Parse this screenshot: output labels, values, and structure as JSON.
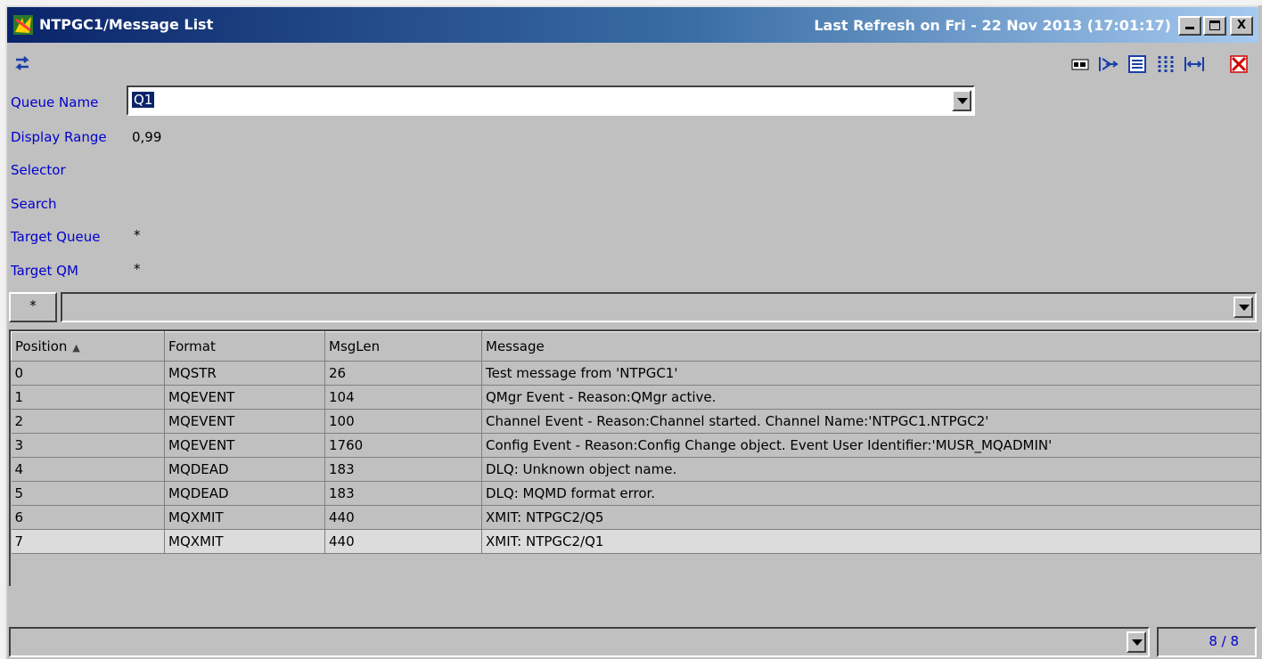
{
  "window": {
    "title": "NTPGC1/Message List",
    "last_refresh": "Last Refresh on Fri - 22 Nov 2013 (17:01:17)",
    "min_label": "_",
    "max_label": "□",
    "close_label": "X"
  },
  "toolbar": {
    "icons": [
      "refresh-icon",
      "message-view-icon",
      "filter-icon",
      "details-icon",
      "columns-icon",
      "fit-width-icon",
      "close-window-icon"
    ]
  },
  "form": {
    "queue_name_label": "Queue Name",
    "queue_name_value": "Q1",
    "display_range_label": "Display Range",
    "display_range_value": "0,99",
    "selector_label": "Selector",
    "search_label": "Search",
    "target_queue_label": "Target Queue",
    "target_queue_value": "*",
    "target_qm_label": "Target QM",
    "target_qm_value": "*"
  },
  "filter": {
    "star_label": "*"
  },
  "table": {
    "columns": [
      "Position",
      "Format",
      "MsgLen",
      "Message"
    ],
    "rows": [
      [
        "0",
        "MQSTR",
        "26",
        "Test message from 'NTPGC1'"
      ],
      [
        "1",
        "MQEVENT",
        "104",
        "QMgr Event - Reason:QMgr active."
      ],
      [
        "2",
        "MQEVENT",
        "100",
        "Channel Event - Reason:Channel started. Channel Name:'NTPGC1.NTPGC2'"
      ],
      [
        "3",
        "MQEVENT",
        "1760",
        "Config Event - Reason:Config Change object. Event User Identifier:'MUSR_MQADMIN'"
      ],
      [
        "4",
        "MQDEAD",
        "183",
        "DLQ: Unknown object name."
      ],
      [
        "5",
        "MQDEAD",
        "183",
        "DLQ: MQMD format error."
      ],
      [
        "6",
        "MQXMIT",
        "440",
        "XMIT: NTPGC2/Q5"
      ],
      [
        "7",
        "MQXMIT",
        "440",
        "XMIT: NTPGC2/Q1"
      ]
    ],
    "selected_row": 7
  },
  "status": {
    "count": "8 / 8"
  },
  "colors": {
    "title_bar_start": "#0a246a",
    "label_blue": "#0000cc",
    "background": "#c0c0c0"
  }
}
